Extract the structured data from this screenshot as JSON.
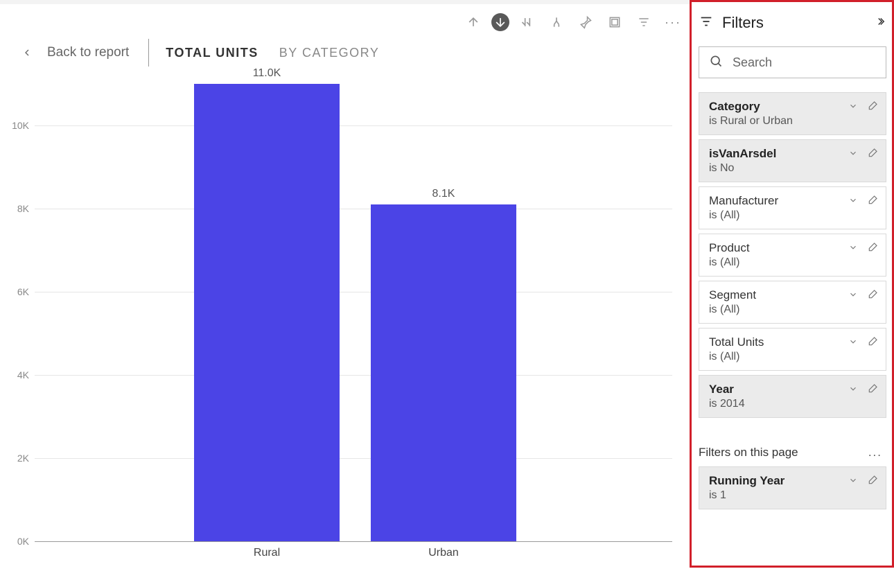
{
  "toolbar": {
    "drill_up": "drill-up",
    "drill_down_active": "drill-down",
    "expand_next": "expand-next",
    "fork": "expand-all",
    "pin": "pin",
    "focus": "focus-mode",
    "filter": "filter",
    "more": "···"
  },
  "drill": {
    "back_label": "Back to report",
    "tabs": [
      "TOTAL UNITS",
      "BY CATEGORY"
    ],
    "active_tab_index": 0
  },
  "chart_data": {
    "type": "bar",
    "categories": [
      "Rural",
      "Urban"
    ],
    "values": [
      11000,
      8100
    ],
    "value_labels": [
      "11.0K",
      "8.1K"
    ],
    "y_ticks": [
      0,
      2000,
      4000,
      6000,
      8000,
      10000
    ],
    "y_tick_labels": [
      "0K",
      "2K",
      "4K",
      "6K",
      "8K",
      "10K"
    ],
    "ymax": 11000,
    "bar_color": "#4b44e6"
  },
  "filters": {
    "pane_title": "Filters",
    "search_placeholder": "Search",
    "visual_filters": [
      {
        "name": "Category",
        "value": "is Rural or Urban",
        "active": true
      },
      {
        "name": "isVanArsdel",
        "value": "is No",
        "active": true
      },
      {
        "name": "Manufacturer",
        "value": "is (All)",
        "active": false
      },
      {
        "name": "Product",
        "value": "is (All)",
        "active": false
      },
      {
        "name": "Segment",
        "value": "is (All)",
        "active": false
      },
      {
        "name": "Total Units",
        "value": "is (All)",
        "active": false
      },
      {
        "name": "Year",
        "value": "is 2014",
        "active": true
      }
    ],
    "page_section_label": "Filters on this page",
    "page_filters": [
      {
        "name": "Running Year",
        "value": "is 1",
        "active": true
      }
    ]
  }
}
